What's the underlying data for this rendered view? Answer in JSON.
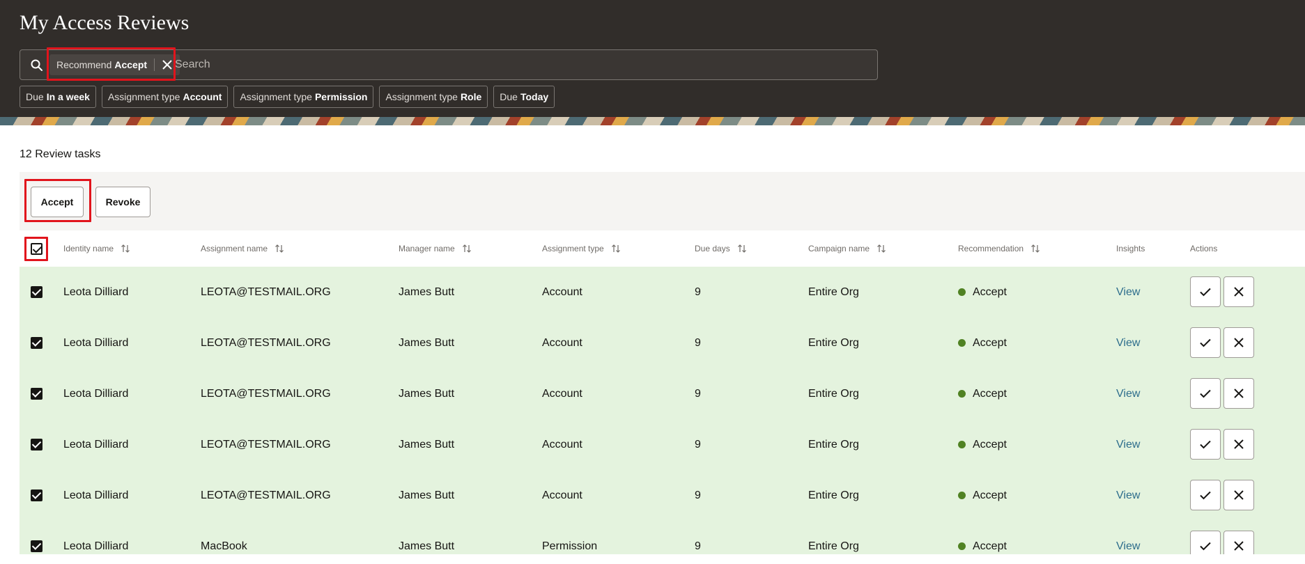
{
  "header": {
    "title": "My Access Reviews",
    "search": {
      "placeholder": "Search",
      "value": "",
      "chip": {
        "label": "Recommend",
        "value": "Accept"
      }
    },
    "filters": [
      {
        "label": "Due",
        "value": "In a week"
      },
      {
        "label": "Assignment type",
        "value": "Account"
      },
      {
        "label": "Assignment type",
        "value": "Permission"
      },
      {
        "label": "Assignment type",
        "value": "Role"
      },
      {
        "label": "Due",
        "value": "Today"
      }
    ]
  },
  "task_count": "12 Review tasks",
  "toolbar": {
    "accept_label": "Accept",
    "revoke_label": "Revoke"
  },
  "table": {
    "columns": [
      "Identity name",
      "Assignment name",
      "Manager name",
      "Assignment type",
      "Due days",
      "Campaign name",
      "Recommendation",
      "Insights",
      "Actions"
    ],
    "rows": [
      {
        "identity": "Leota Dilliard",
        "assignment": "LEOTA@TESTMAIL.ORG",
        "manager": "James Butt",
        "type": "Account",
        "due": "9",
        "campaign": "Entire Org",
        "recommendation": "Accept",
        "insights": "View",
        "checked": true
      },
      {
        "identity": "Leota Dilliard",
        "assignment": "LEOTA@TESTMAIL.ORG",
        "manager": "James Butt",
        "type": "Account",
        "due": "9",
        "campaign": "Entire Org",
        "recommendation": "Accept",
        "insights": "View",
        "checked": true
      },
      {
        "identity": "Leota Dilliard",
        "assignment": "LEOTA@TESTMAIL.ORG",
        "manager": "James Butt",
        "type": "Account",
        "due": "9",
        "campaign": "Entire Org",
        "recommendation": "Accept",
        "insights": "View",
        "checked": true
      },
      {
        "identity": "Leota Dilliard",
        "assignment": "LEOTA@TESTMAIL.ORG",
        "manager": "James Butt",
        "type": "Account",
        "due": "9",
        "campaign": "Entire Org",
        "recommendation": "Accept",
        "insights": "View",
        "checked": true
      },
      {
        "identity": "Leota Dilliard",
        "assignment": "LEOTA@TESTMAIL.ORG",
        "manager": "James Butt",
        "type": "Account",
        "due": "9",
        "campaign": "Entire Org",
        "recommendation": "Accept",
        "insights": "View",
        "checked": true
      },
      {
        "identity": "Leota Dilliard",
        "assignment": "MacBook",
        "manager": "James Butt",
        "type": "Permission",
        "due": "9",
        "campaign": "Entire Org",
        "recommendation": "Accept",
        "insights": "View",
        "checked": true
      }
    ]
  },
  "colors": {
    "header_bg": "#312d2a",
    "row_bg": "#e4f3de",
    "accept_dot": "#508223",
    "link": "#2d6d8c",
    "highlight": "#e1141c"
  },
  "icons": [
    "search-icon",
    "close-icon",
    "sort-icon",
    "checkmark-icon",
    "x-icon"
  ]
}
